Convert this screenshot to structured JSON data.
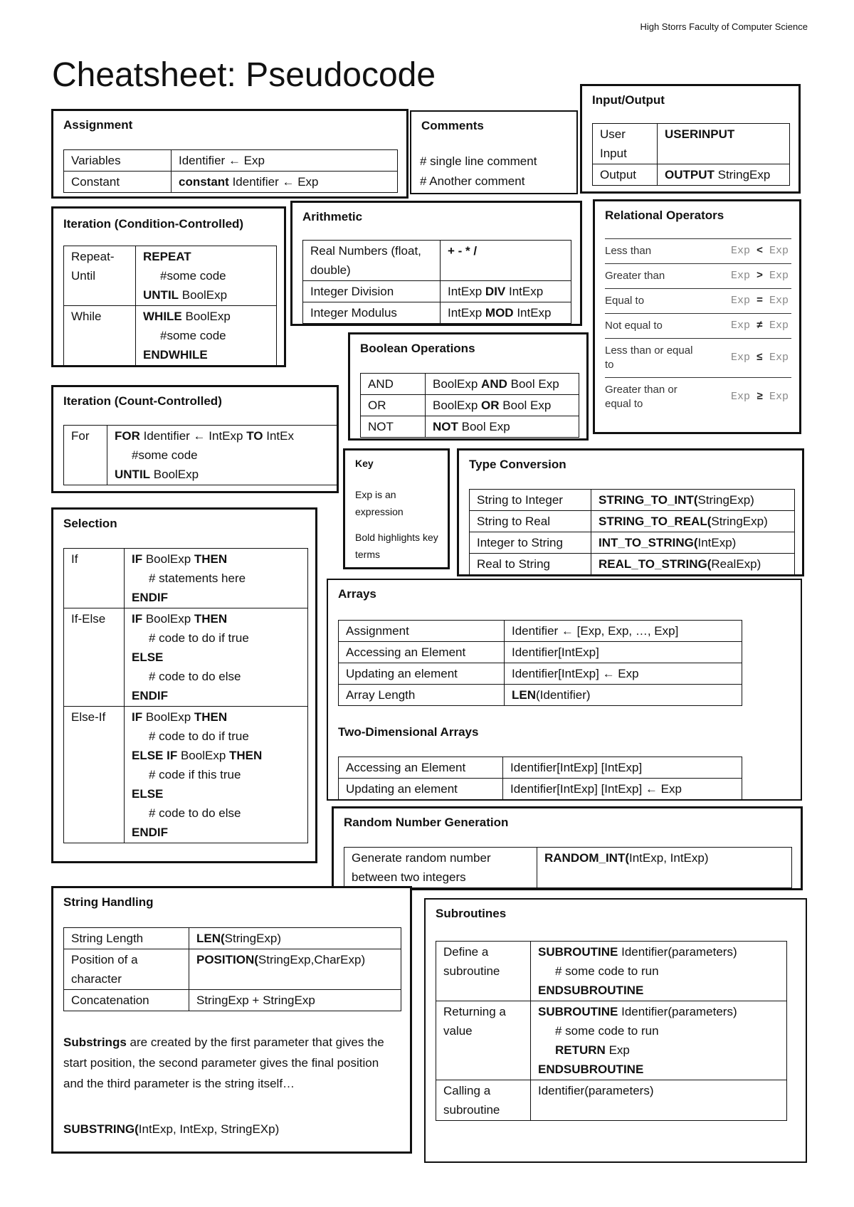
{
  "header": {
    "organization": "High Storrs Faculty of Computer Science",
    "title": "Cheatsheet: Pseudocode"
  },
  "assignment": {
    "title": "Assignment",
    "rows": [
      {
        "label": "Variables",
        "code": [
          [
            {
              "t": "Identifier "
            },
            {
              "t": "←",
              "b": true
            },
            {
              "t": " Exp"
            }
          ]
        ]
      },
      {
        "label": "Constant",
        "code": [
          [
            {
              "t": "constant",
              "b": true
            },
            {
              "t": " Identifier ← Exp"
            }
          ]
        ]
      }
    ]
  },
  "comments": {
    "title": "Comments",
    "lines": [
      "# single line comment",
      "# Another comment"
    ]
  },
  "io": {
    "title": "Input/Output",
    "rows": [
      {
        "label": "User Input",
        "code": [
          [
            {
              "t": "USERINPUT",
              "b": true
            }
          ]
        ]
      },
      {
        "label": "Output",
        "code": [
          [
            {
              "t": "OUTPUT",
              "b": true
            },
            {
              "t": " StringExp"
            }
          ]
        ]
      }
    ]
  },
  "iteration_condition": {
    "title": "Iteration (Condition-Controlled)",
    "rows": [
      {
        "label": "Repeat-Until",
        "code": [
          [
            {
              "t": "REPEAT",
              "b": true
            }
          ],
          [
            {
              "t": "#some code",
              "i": true
            }
          ],
          [
            {
              "t": "UNTIL",
              "b": true
            },
            {
              "t": " BoolExp"
            }
          ]
        ]
      },
      {
        "label": "While",
        "code": [
          [
            {
              "t": "WHILE",
              "b": true
            },
            {
              "t": " BoolExp"
            }
          ],
          [
            {
              "t": "#some code",
              "i": true
            }
          ],
          [
            {
              "t": "ENDWHILE",
              "b": true
            }
          ]
        ]
      }
    ]
  },
  "arithmetic": {
    "title": "Arithmetic",
    "rows": [
      {
        "label": "Real Numbers (float, double)",
        "code": [
          [
            {
              "t": "+ - * /",
              "b": true
            }
          ]
        ]
      },
      {
        "label": "Integer Division",
        "code": [
          [
            {
              "t": "IntExp "
            },
            {
              "t": "DIV",
              "b": true
            },
            {
              "t": " IntExp"
            }
          ]
        ]
      },
      {
        "label": "Integer Modulus",
        "code": [
          [
            {
              "t": "IntExp "
            },
            {
              "t": "MOD",
              "b": true
            },
            {
              "t": " IntExp"
            }
          ]
        ]
      }
    ]
  },
  "relational": {
    "title": "Relational Operators",
    "rows": [
      {
        "label": "Less than",
        "left": "Exp",
        "op": "<",
        "right": "Exp"
      },
      {
        "label": "Greater than",
        "left": "Exp",
        "op": ">",
        "right": "Exp"
      },
      {
        "label": "Equal to",
        "left": "Exp",
        "op": "=",
        "right": "Exp"
      },
      {
        "label": "Not equal to",
        "left": "Exp",
        "op": "≠",
        "right": "Exp"
      },
      {
        "label": "Less than or equal to",
        "left": "Exp",
        "op": "≤",
        "right": "Exp"
      },
      {
        "label": "Greater than or equal to",
        "left": "Exp",
        "op": "≥",
        "right": "Exp"
      }
    ]
  },
  "boolean": {
    "title": "Boolean Operations",
    "rows": [
      {
        "label": "AND",
        "code": [
          [
            {
              "t": "BoolExp "
            },
            {
              "t": "AND",
              "b": true
            },
            {
              "t": " Bool Exp"
            }
          ]
        ]
      },
      {
        "label": "OR",
        "code": [
          [
            {
              "t": "BoolExp "
            },
            {
              "t": "OR",
              "b": true
            },
            {
              "t": " Bool Exp"
            }
          ]
        ]
      },
      {
        "label": "NOT",
        "code": [
          [
            {
              "t": "NOT",
              "b": true
            },
            {
              "t": " Bool Exp"
            }
          ]
        ]
      }
    ]
  },
  "iteration_count": {
    "title": "Iteration (Count-Controlled)",
    "rows": [
      {
        "label": "For",
        "code": [
          [
            {
              "t": "FOR",
              "b": true
            },
            {
              "t": " Identifier ← IntExp "
            },
            {
              "t": "TO",
              "b": true
            },
            {
              "t": " IntEx"
            }
          ],
          [
            {
              "t": "#some code",
              "i": true
            }
          ],
          [
            {
              "t": "UNTIL",
              "b": true
            },
            {
              "t": " BoolExp"
            }
          ]
        ]
      }
    ]
  },
  "key": {
    "title": "Key",
    "lines": [
      "Exp is an expression",
      "Bold highlights key terms"
    ]
  },
  "type_conversion": {
    "title": "Type Conversion",
    "rows": [
      {
        "label": "String to Integer",
        "code": [
          [
            {
              "t": "STRING_TO_INT(",
              "b": true
            },
            {
              "t": "StringExp)"
            }
          ]
        ]
      },
      {
        "label": "String to Real",
        "code": [
          [
            {
              "t": "STRING_TO_REAL(",
              "b": true
            },
            {
              "t": "StringExp)"
            }
          ]
        ]
      },
      {
        "label": "Integer to String",
        "code": [
          [
            {
              "t": "INT_TO_STRING(",
              "b": true
            },
            {
              "t": "IntExp)"
            }
          ]
        ]
      },
      {
        "label": "Real to String",
        "code": [
          [
            {
              "t": "REAL_TO_STRING(",
              "b": true
            },
            {
              "t": "RealExp)"
            }
          ]
        ]
      }
    ]
  },
  "selection": {
    "title": "Selection",
    "rows": [
      {
        "label": "If",
        "code": [
          [
            {
              "t": "IF",
              "b": true
            },
            {
              "t": " BoolExp "
            },
            {
              "t": "THEN",
              "b": true
            }
          ],
          [
            {
              "t": "# statements here",
              "i": true
            }
          ],
          [
            {
              "t": "ENDIF",
              "b": true
            }
          ]
        ]
      },
      {
        "label": "If-Else",
        "code": [
          [
            {
              "t": "IF",
              "b": true
            },
            {
              "t": " BoolExp "
            },
            {
              "t": "THEN",
              "b": true
            }
          ],
          [
            {
              "t": "# code to do if true",
              "i": true
            }
          ],
          [
            {
              "t": "ELSE",
              "b": true
            }
          ],
          [
            {
              "t": "# code to do else",
              "i": true
            }
          ],
          [
            {
              "t": "ENDIF",
              "b": true
            }
          ]
        ]
      },
      {
        "label": "Else-If",
        "code": [
          [
            {
              "t": "IF",
              "b": true
            },
            {
              "t": " BoolExp "
            },
            {
              "t": "THEN",
              "b": true
            }
          ],
          [
            {
              "t": "# code to do if true",
              "i": true
            }
          ],
          [
            {
              "t": "ELSE IF",
              "b": true
            },
            {
              "t": " BoolExp "
            },
            {
              "t": "THEN",
              "b": true
            }
          ],
          [
            {
              "t": "# code if this true",
              "i": true
            }
          ],
          [
            {
              "t": "ELSE",
              "b": true
            }
          ],
          [
            {
              "t": "# code to do else",
              "i": true
            }
          ],
          [
            {
              "t": "ENDIF",
              "b": true
            }
          ]
        ]
      }
    ]
  },
  "arrays": {
    "title": "Arrays",
    "rows": [
      {
        "label": "Assignment",
        "code": [
          [
            {
              "t": "Identifier ← [Exp, Exp, …, Exp]"
            }
          ]
        ]
      },
      {
        "label": "Accessing an Element",
        "code": [
          [
            {
              "t": "Identifier[IntExp]"
            }
          ]
        ]
      },
      {
        "label": "Updating an element",
        "code": [
          [
            {
              "t": "Identifier[IntExp] ← Exp"
            }
          ]
        ]
      },
      {
        "label": "Array Length",
        "code": [
          [
            {
              "t": "LEN",
              "b": true
            },
            {
              "t": "(Identifier)"
            }
          ]
        ]
      }
    ],
    "two_d_title": "Two-Dimensional Arrays",
    "two_d_rows": [
      {
        "label": "Accessing an Element",
        "code": [
          [
            {
              "t": "Identifier[IntExp] [IntExp]"
            }
          ]
        ]
      },
      {
        "label": "Updating an element",
        "code": [
          [
            {
              "t": "Identifier[IntExp] [IntExp] ← Exp"
            }
          ]
        ]
      }
    ]
  },
  "random": {
    "title": "Random Number Generation",
    "rows": [
      {
        "label": "Generate random number between two integers",
        "code": [
          [
            {
              "t": "RANDOM_INT(",
              "b": true
            },
            {
              "t": "IntExp, IntExp)"
            }
          ]
        ]
      }
    ]
  },
  "strings": {
    "title": "String Handling",
    "rows": [
      {
        "label": "String Length",
        "code": [
          [
            {
              "t": "LEN(",
              "b": true
            },
            {
              "t": "StringExp)"
            }
          ]
        ]
      },
      {
        "label": "Position of a character",
        "code": [
          [
            {
              "t": "POSITION(",
              "b": true
            },
            {
              "t": "StringExp,CharExp)"
            }
          ]
        ]
      },
      {
        "label": "Concatenation",
        "code": [
          [
            {
              "t": "StringExp + StringExp"
            }
          ]
        ]
      }
    ],
    "paragraph": [
      {
        "t": "Substrings",
        "b": true
      },
      {
        "t": " are created by the first parameter that gives the start position, the second parameter gives the final position and the third parameter is the string itself…"
      }
    ],
    "syntax": [
      {
        "t": "SUBSTRING(",
        "b": true
      },
      {
        "t": "IntExp, IntExp, StringEXp)"
      }
    ]
  },
  "subroutines": {
    "title": "Subroutines",
    "rows": [
      {
        "label": "Define a subroutine",
        "code": [
          [
            {
              "t": "SUBROUTINE",
              "b": true
            },
            {
              "t": " Identifier(parameters)"
            }
          ],
          [
            {
              "t": "# some code to run",
              "i": true
            }
          ],
          [
            {
              "t": "ENDSUBROUTINE",
              "b": true
            }
          ]
        ]
      },
      {
        "label": "Returning a value",
        "code": [
          [
            {
              "t": "SUBROUTINE",
              "b": true
            },
            {
              "t": " Identifier(parameters)"
            }
          ],
          [
            {
              "t": "# some code to run",
              "i": true
            }
          ],
          [
            {
              "t": "RETURN",
              "b": true,
              "i": true
            },
            {
              "t": " Exp",
              "i": true
            }
          ],
          [
            {
              "t": "ENDSUBROUTINE",
              "b": true
            }
          ]
        ]
      },
      {
        "label": "Calling a subroutine",
        "code": [
          [
            {
              "t": "Identifier(parameters)"
            }
          ]
        ]
      }
    ]
  }
}
